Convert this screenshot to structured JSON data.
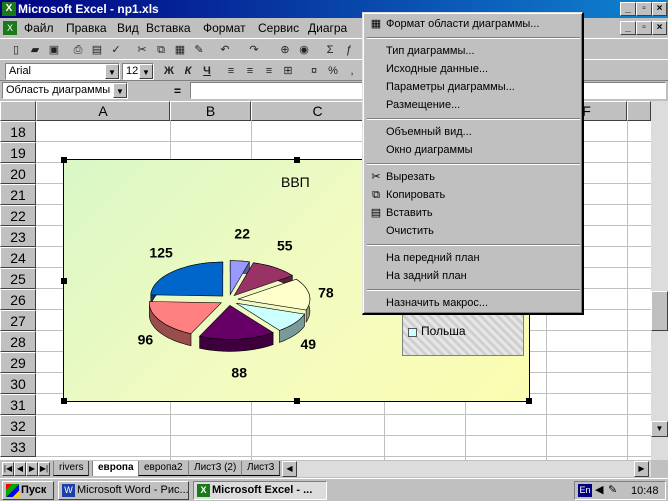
{
  "window": {
    "title": "Microsoft Excel - np1.xls"
  },
  "menu": {
    "file": "Файл",
    "edit": "Правка",
    "view": "Вид",
    "insert": "Вставка",
    "format": "Формат",
    "tools": "Сервис",
    "chart": "Диагра"
  },
  "formatting": {
    "font_name": "Arial",
    "font_size": "12",
    "bold": "Ж",
    "italic": "К",
    "underline": "Ч"
  },
  "formula_bar": {
    "name_box": "Область диаграммы",
    "equals": "="
  },
  "grid": {
    "columns": [
      "A",
      "B",
      "C",
      "F"
    ],
    "rows": [
      "18",
      "19",
      "20",
      "21",
      "22",
      "23",
      "24",
      "25",
      "26",
      "27",
      "28",
      "29",
      "30",
      "31",
      "32",
      "33"
    ]
  },
  "chart_data": {
    "type": "pie",
    "title": "ВВП",
    "values": [
      22,
      55,
      78,
      49,
      88,
      96,
      125
    ],
    "colors": [
      "#9999ff",
      "#993366",
      "#ffffcc",
      "#ccffff",
      "#660066",
      "#ff8080",
      "#0066cc"
    ],
    "legend": [
      "Польша"
    ],
    "legend_placement": "right"
  },
  "context_menu": {
    "items": [
      {
        "label": "Формат области диаграммы...",
        "icon": "format-icon"
      },
      {
        "label": "Тип диаграммы..."
      },
      {
        "label": "Исходные данные..."
      },
      {
        "label": "Параметры диаграммы..."
      },
      {
        "label": "Размещение..."
      },
      {
        "label": "Объемный вид..."
      },
      {
        "label": "Окно диаграммы"
      },
      {
        "label": "Вырезать",
        "icon": "scissors-icon"
      },
      {
        "label": "Копировать",
        "icon": "copy-icon"
      },
      {
        "label": "Вставить",
        "icon": "paste-icon"
      },
      {
        "label": "Очистить"
      },
      {
        "label": "На передний план"
      },
      {
        "label": "На задний план"
      },
      {
        "label": "Назначить макрос..."
      }
    ]
  },
  "sheet_tabs": [
    "rivers",
    "европа",
    "европа2",
    "Лист3 (2)",
    "Лист3"
  ],
  "taskbar": {
    "start": "Пуск",
    "task1": "Microsoft Word - Рис...",
    "task2": "Microsoft Excel - ...",
    "lang": "En",
    "clock": "10:48"
  },
  "colors": {
    "titlebar": "#000080",
    "chart_bg": "#f3fbc0"
  }
}
